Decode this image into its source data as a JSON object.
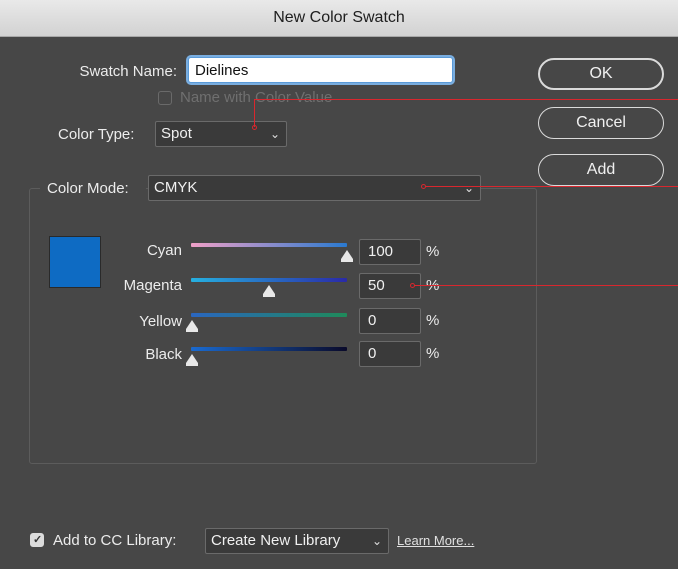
{
  "window": {
    "title": "New Color Swatch"
  },
  "swatch_name": {
    "label": "Swatch Name:",
    "value": "Dielines"
  },
  "name_with_color_value": {
    "label": "Name with Color Value",
    "checked": false,
    "enabled": false
  },
  "color_type": {
    "label": "Color Type:",
    "value": "Spot"
  },
  "color_mode": {
    "label": "Color Mode:",
    "value": "CMYK"
  },
  "preview_color": "#0E6BC3",
  "sliders": [
    {
      "label": "Cyan",
      "value": "100",
      "unit": "%",
      "fraction": 1.0
    },
    {
      "label": "Magenta",
      "value": "50",
      "unit": "%",
      "fraction": 0.5
    },
    {
      "label": "Yellow",
      "value": "0",
      "unit": "%",
      "fraction": 0.0
    },
    {
      "label": "Black",
      "value": "0",
      "unit": "%",
      "fraction": 0.0
    }
  ],
  "buttons": {
    "ok": "OK",
    "cancel": "Cancel",
    "add": "Add"
  },
  "cc_library": {
    "checkbox_label": "Add to CC Library:",
    "checked": true,
    "library_value": "Create New Library",
    "learn_more": "Learn More..."
  },
  "icons": {
    "dropdown": "chevron-down-icon",
    "checkmark": "checkmark-icon"
  },
  "annotation_color": "#D9272E"
}
